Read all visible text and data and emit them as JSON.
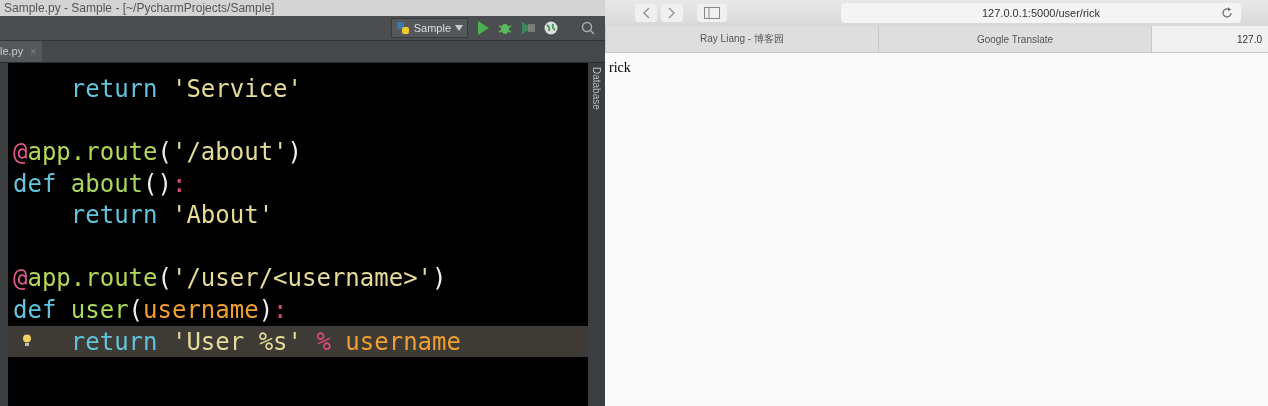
{
  "ide": {
    "title": "Sample.py - Sample - [~/PycharmProjects/Sample]",
    "run_config": "Sample",
    "tab": {
      "label": "le.py",
      "close": "×"
    },
    "side_tab": "Database",
    "lines": [
      {
        "current": false,
        "indented": true,
        "tokens": [
          {
            "t": "return ",
            "kind": "keyword"
          },
          {
            "t": "'Service'",
            "kind": "string"
          }
        ]
      },
      {
        "current": false
      },
      {
        "current": false,
        "indented": false,
        "tokens": [
          {
            "t": "@",
            "kind": "at"
          },
          {
            "t": "app.route",
            "kind": "decorator"
          },
          {
            "t": "(",
            "kind": "plain"
          },
          {
            "t": "'/about'",
            "kind": "string"
          },
          {
            "t": ")",
            "kind": "plain"
          }
        ]
      },
      {
        "current": false,
        "indented": false,
        "tokens": [
          {
            "t": "def ",
            "kind": "keyword"
          },
          {
            "t": "about",
            "kind": "func"
          },
          {
            "t": "()",
            "kind": "plain"
          },
          {
            "t": ":",
            "kind": "op"
          }
        ]
      },
      {
        "current": false,
        "indented": true,
        "tokens": [
          {
            "t": "return ",
            "kind": "keyword"
          },
          {
            "t": "'About'",
            "kind": "string"
          }
        ]
      },
      {
        "current": false
      },
      {
        "current": false,
        "indented": false,
        "tokens": [
          {
            "t": "@",
            "kind": "at"
          },
          {
            "t": "app.route",
            "kind": "decorator"
          },
          {
            "t": "(",
            "kind": "plain"
          },
          {
            "t": "'/user/<username>'",
            "kind": "string"
          },
          {
            "t": ")",
            "kind": "plain"
          }
        ]
      },
      {
        "current": false,
        "indented": false,
        "tokens": [
          {
            "t": "def ",
            "kind": "keyword"
          },
          {
            "t": "user",
            "kind": "func"
          },
          {
            "t": "(",
            "kind": "plain"
          },
          {
            "t": "username",
            "kind": "param"
          },
          {
            "t": ")",
            "kind": "plain"
          },
          {
            "t": ":",
            "kind": "op"
          }
        ]
      },
      {
        "current": true,
        "indented": true,
        "tokens": [
          {
            "t": "return ",
            "kind": "keyword"
          },
          {
            "t": "'User %s' ",
            "kind": "string"
          },
          {
            "t": "% ",
            "kind": "op"
          },
          {
            "t": "username",
            "kind": "param"
          }
        ]
      }
    ]
  },
  "browser": {
    "address": "127.0.0.1:5000/user/rick",
    "tabs": [
      {
        "label": "Ray Liang - 博客园",
        "selected": false
      },
      {
        "label": "Google Translate",
        "selected": false
      },
      {
        "label": "127.0",
        "selected": true
      }
    ],
    "content": "rick"
  }
}
